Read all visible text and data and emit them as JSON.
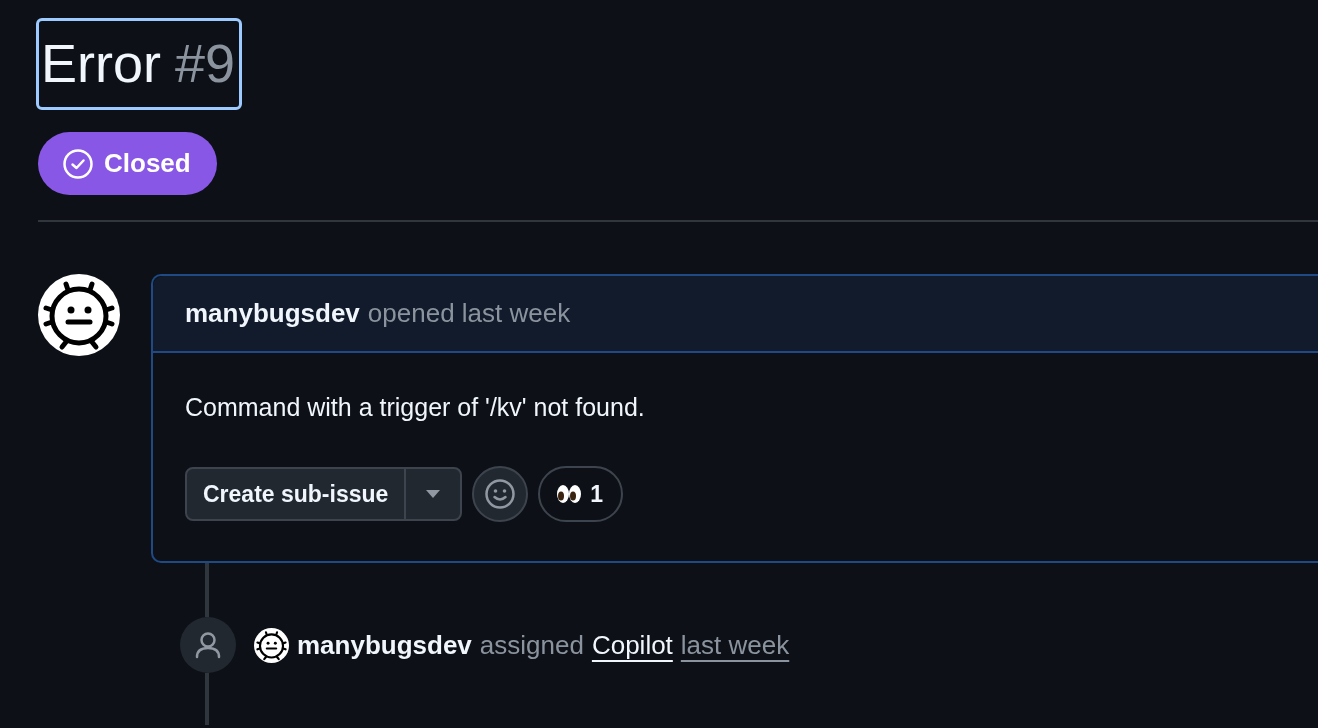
{
  "title": {
    "text": "Error",
    "number": "#9",
    "focused": true
  },
  "state": {
    "kind": "closed",
    "label": "Closed"
  },
  "comment": {
    "author": "manybugsdev",
    "action": "opened last week",
    "body": "Command with a trigger of '/kv' not found.",
    "split_button": {
      "label": "Create sub-issue"
    },
    "reactions": [
      {
        "kind": "eyes",
        "count": "1"
      }
    ]
  },
  "event": {
    "author": "manybugsdev",
    "action": "assigned",
    "assignee": "Copilot",
    "time": "last week"
  }
}
